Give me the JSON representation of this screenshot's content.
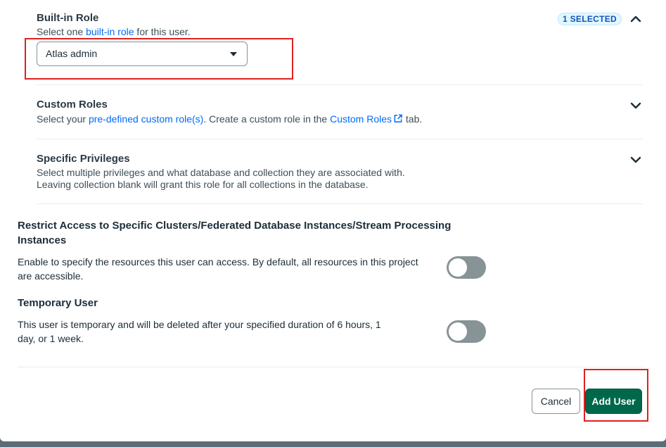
{
  "builtin_role": {
    "title": "Built-in Role",
    "desc_prefix": "Select one ",
    "desc_link": "built-in role",
    "desc_suffix": " for this user.",
    "badge": "1 SELECTED",
    "selected_value": "Atlas admin",
    "expanded": true
  },
  "custom_roles": {
    "title": "Custom Roles",
    "desc_prefix": "Select your ",
    "desc_link": "pre-defined custom role(s)",
    "desc_middle": ". Create a custom role in the ",
    "desc_link2": "Custom Roles",
    "desc_suffix": " tab."
  },
  "specific_privileges": {
    "title": "Specific Privileges",
    "desc_line1": "Select multiple privileges and what database and collection they are associated with.",
    "desc_line2": "Leaving collection blank will grant this role for all collections in the database."
  },
  "restrict_access": {
    "title_line1": "Restrict Access to Specific Clusters/Federated Database Instances/Stream Processing",
    "title_line2": "Instances",
    "desc_line1": "Enable to specify the resources this user can access. By default, all resources in this project",
    "desc_line2": "are accessible.",
    "enabled": false
  },
  "temporary_user": {
    "title": "Temporary User",
    "desc_line1": "This user is temporary and will be deleted after your specified duration of 6 hours, 1",
    "desc_line2": "day, or 1 week.",
    "enabled": false
  },
  "footer": {
    "cancel_label": "Cancel",
    "add_label": "Add User"
  },
  "colors": {
    "link": "#016bf8",
    "primary_button": "#00684a",
    "toggle_off": "#889397",
    "highlight": "#e02020"
  }
}
